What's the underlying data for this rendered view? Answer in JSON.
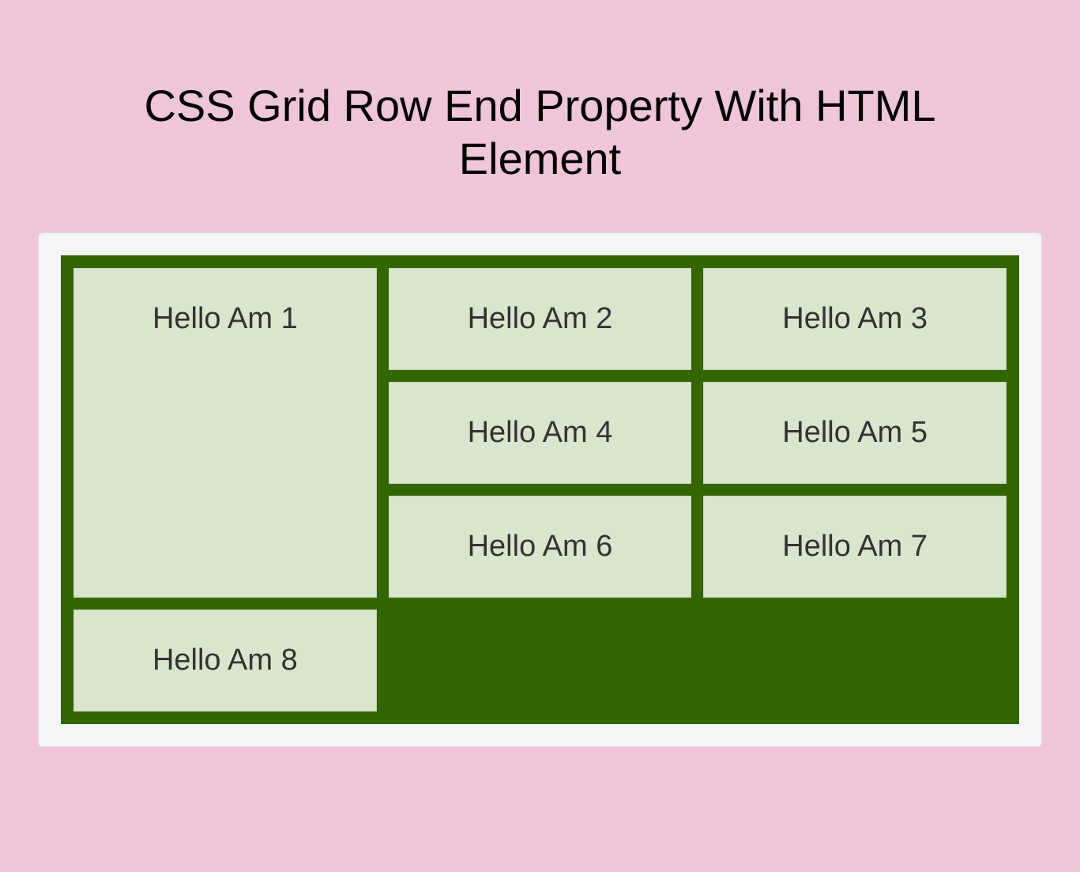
{
  "title": "CSS Grid Row End Property With HTML Element",
  "grid": {
    "items": [
      "Hello Am 1",
      "Hello Am 2",
      "Hello Am 3",
      "Hello Am 4",
      "Hello Am 5",
      "Hello Am 6",
      "Hello Am 7",
      "Hello Am 8"
    ]
  }
}
